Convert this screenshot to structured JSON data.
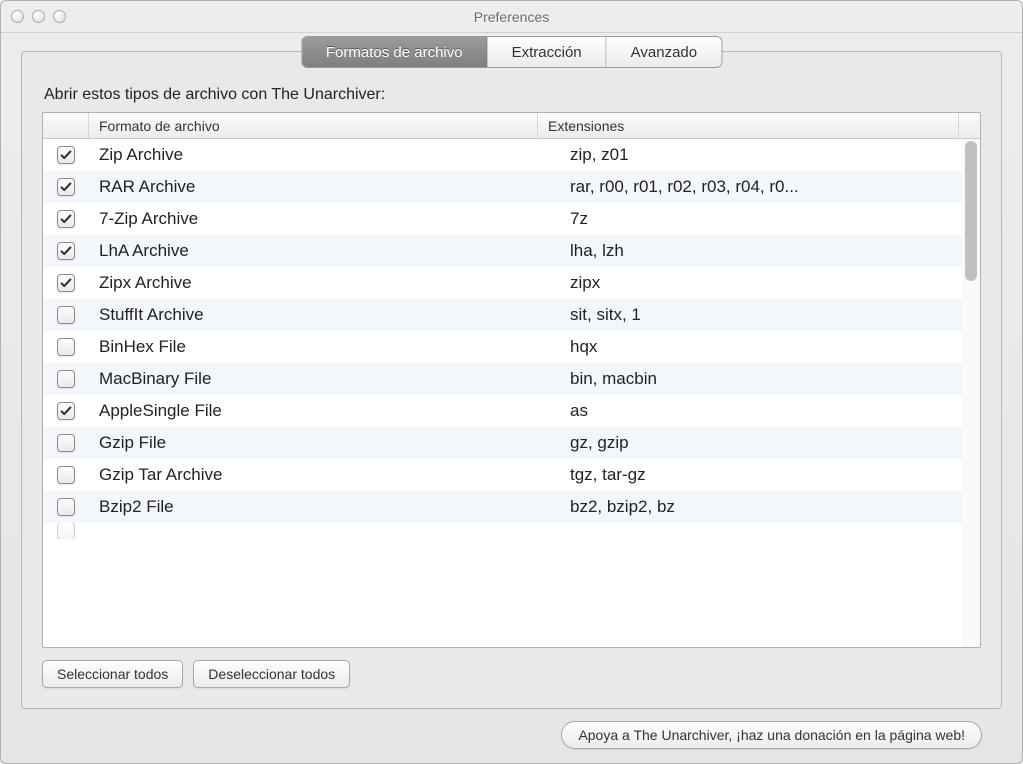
{
  "window": {
    "title": "Preferences"
  },
  "tabs": [
    {
      "label": "Formatos de archivo",
      "active": true
    },
    {
      "label": "Extracción",
      "active": false
    },
    {
      "label": "Avanzado",
      "active": false
    }
  ],
  "section_label": "Abrir estos tipos de archivo con The Unarchiver:",
  "columns": {
    "format": "Formato de archivo",
    "extensions": "Extensiones"
  },
  "rows": [
    {
      "checked": true,
      "name": "Zip Archive",
      "ext": "zip, z01"
    },
    {
      "checked": true,
      "name": "RAR Archive",
      "ext": "rar, r00, r01, r02, r03, r04, r0..."
    },
    {
      "checked": true,
      "name": "7-Zip Archive",
      "ext": "7z"
    },
    {
      "checked": true,
      "name": "LhA Archive",
      "ext": "lha, lzh"
    },
    {
      "checked": true,
      "name": "Zipx Archive",
      "ext": "zipx"
    },
    {
      "checked": false,
      "name": "StuffIt Archive",
      "ext": "sit, sitx, 1"
    },
    {
      "checked": false,
      "name": "BinHex File",
      "ext": "hqx"
    },
    {
      "checked": false,
      "name": "MacBinary File",
      "ext": "bin, macbin"
    },
    {
      "checked": true,
      "name": "AppleSingle File",
      "ext": "as"
    },
    {
      "checked": false,
      "name": "Gzip File",
      "ext": "gz, gzip"
    },
    {
      "checked": false,
      "name": "Gzip Tar Archive",
      "ext": "tgz, tar-gz"
    },
    {
      "checked": false,
      "name": "Bzip2 File",
      "ext": "bz2, bzip2, bz"
    }
  ],
  "buttons": {
    "select_all": "Seleccionar todos",
    "deselect_all": "Deseleccionar todos"
  },
  "footer": {
    "donate": "Apoya a The Unarchiver, ¡haz una donación en la página web!"
  }
}
